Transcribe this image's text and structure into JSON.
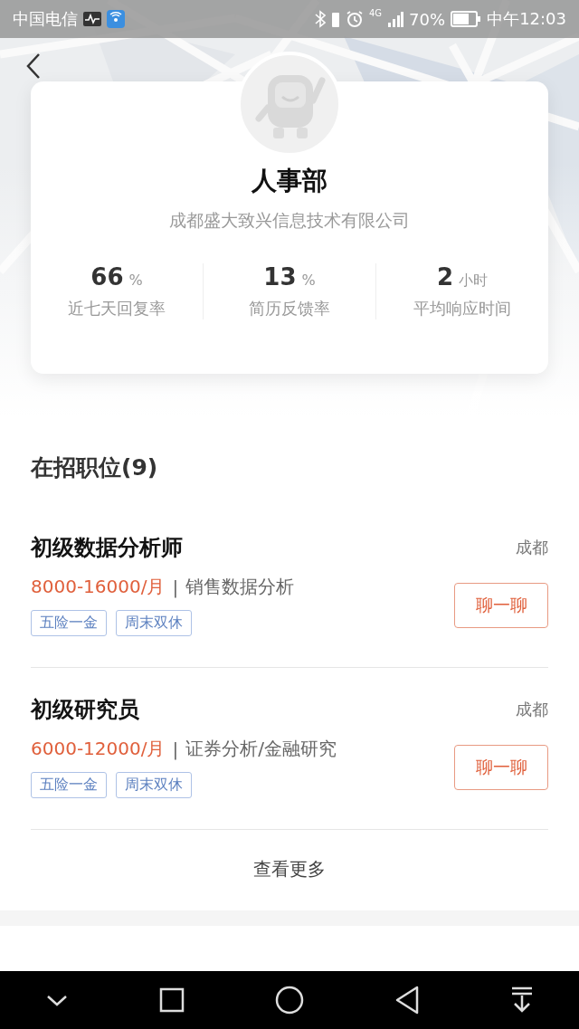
{
  "status_bar": {
    "carrier": "中国电信",
    "network": "4G",
    "battery": "70%",
    "time": "中午12:03"
  },
  "profile": {
    "name": "人事部",
    "company": "成都盛大致兴信息技术有限公司",
    "stats": [
      {
        "value": "66",
        "unit": "%",
        "label": "近七天回复率"
      },
      {
        "value": "13",
        "unit": "%",
        "label": "简历反馈率"
      },
      {
        "value": "2",
        "unit": "小时",
        "label": "平均响应时间"
      }
    ]
  },
  "jobs_section": {
    "title": "在招职位(9)",
    "jobs": [
      {
        "title": "初级数据分析师",
        "city": "成都",
        "salary": "8000-16000/月",
        "separator": "|",
        "category": "销售数据分析",
        "tags": [
          "五险一金",
          "周末双休"
        ],
        "action": "聊一聊"
      },
      {
        "title": "初级研究员",
        "city": "成都",
        "salary": "6000-12000/月",
        "separator": "|",
        "category": "证券分析/金融研究",
        "tags": [
          "五险一金",
          "周末双休"
        ],
        "action": "聊一聊"
      }
    ],
    "more": "查看更多"
  }
}
